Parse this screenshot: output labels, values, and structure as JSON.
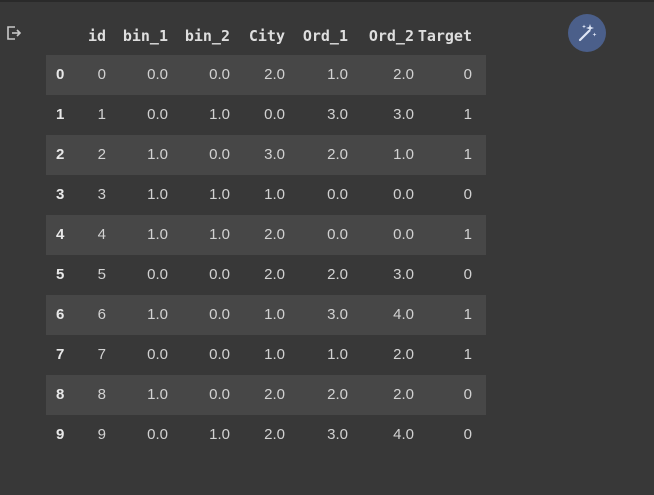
{
  "table": {
    "columns": [
      "id",
      "bin_1",
      "bin_2",
      "City",
      "Ord_1",
      "Ord_2",
      "Target"
    ],
    "rows": [
      {
        "index": "0",
        "cells": [
          "0",
          "0.0",
          "0.0",
          "2.0",
          "1.0",
          "2.0",
          "0"
        ]
      },
      {
        "index": "1",
        "cells": [
          "1",
          "0.0",
          "1.0",
          "0.0",
          "3.0",
          "3.0",
          "1"
        ]
      },
      {
        "index": "2",
        "cells": [
          "2",
          "1.0",
          "0.0",
          "3.0",
          "2.0",
          "1.0",
          "1"
        ]
      },
      {
        "index": "3",
        "cells": [
          "3",
          "1.0",
          "1.0",
          "1.0",
          "0.0",
          "0.0",
          "0"
        ]
      },
      {
        "index": "4",
        "cells": [
          "4",
          "1.0",
          "1.0",
          "2.0",
          "0.0",
          "0.0",
          "1"
        ]
      },
      {
        "index": "5",
        "cells": [
          "5",
          "0.0",
          "0.0",
          "2.0",
          "2.0",
          "3.0",
          "0"
        ]
      },
      {
        "index": "6",
        "cells": [
          "6",
          "1.0",
          "0.0",
          "1.0",
          "3.0",
          "4.0",
          "1"
        ]
      },
      {
        "index": "7",
        "cells": [
          "7",
          "0.0",
          "0.0",
          "1.0",
          "1.0",
          "2.0",
          "1"
        ]
      },
      {
        "index": "8",
        "cells": [
          "8",
          "1.0",
          "0.0",
          "2.0",
          "2.0",
          "2.0",
          "0"
        ]
      },
      {
        "index": "9",
        "cells": [
          "9",
          "0.0",
          "1.0",
          "2.0",
          "3.0",
          "4.0",
          "0"
        ]
      }
    ]
  },
  "icons": {
    "output": "output-redirect-icon",
    "magic": "magic-wand-icon"
  },
  "colors": {
    "background": "#383838",
    "row_stripe": "#474747",
    "magic_button": "#4b5f8a"
  }
}
